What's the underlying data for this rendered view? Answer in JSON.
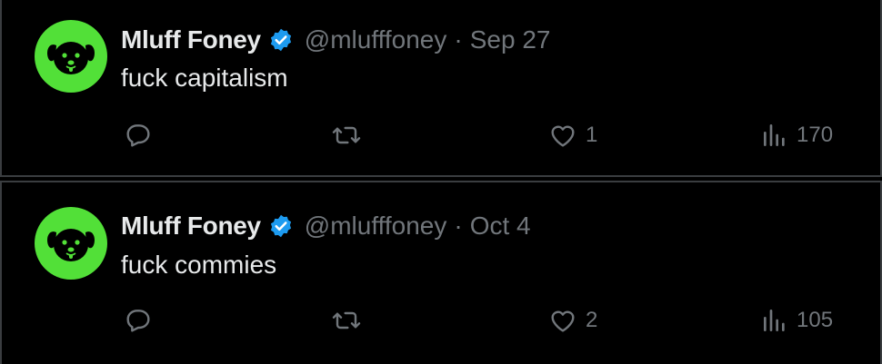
{
  "tweets": [
    {
      "author": {
        "name": "Mluff Foney",
        "handle": "@mlufffoney",
        "verified": true
      },
      "separator": "·",
      "date": "Sep 27",
      "text": "fuck capitalism",
      "stats": {
        "replies": "",
        "retweets": "",
        "likes": "1",
        "views": "170"
      }
    },
    {
      "author": {
        "name": "Mluff Foney",
        "handle": "@mlufffoney",
        "verified": true
      },
      "separator": "·",
      "date": "Oct 4",
      "text": "fuck commies",
      "stats": {
        "replies": "",
        "retweets": "",
        "likes": "2",
        "views": "105"
      }
    }
  ],
  "colors": {
    "background": "#000000",
    "text": "#e7e9ea",
    "muted": "#71767b",
    "verified_badge": "#1d9bf0",
    "avatar_bg": "#52e038"
  },
  "icons": [
    "dog-avatar-icon",
    "verified-badge-icon",
    "reply-icon",
    "retweet-icon",
    "like-icon",
    "views-icon"
  ]
}
